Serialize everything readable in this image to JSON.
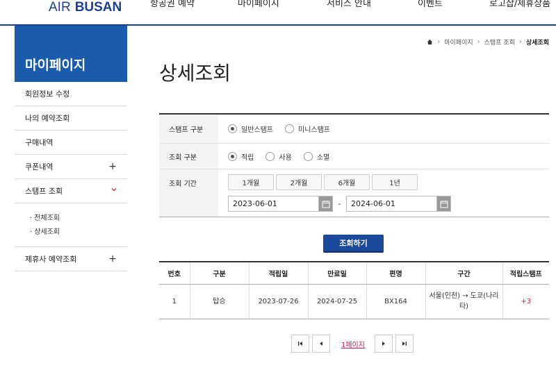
{
  "header": {
    "logo": {
      "air": "AIR",
      "busan": "BUSAN"
    },
    "menu": [
      "항공권 예약",
      "마이페이지",
      "서비스 안내",
      "이벤트",
      "로고샵/제휴상품"
    ]
  },
  "sidebar": {
    "title": "마이페이지",
    "items": [
      {
        "label": "회원정보 수정"
      },
      {
        "label": "나의 예약조회"
      },
      {
        "label": "구매내역"
      },
      {
        "label": "쿠폰내역",
        "expand": "+"
      },
      {
        "label": "스탬프 조회"
      },
      {
        "label": "제휴사 예약조회",
        "expand": "+"
      }
    ],
    "sub_items": [
      "전체조회",
      "상세조회"
    ]
  },
  "breadcrumb": [
    "마이페이지",
    "스탬프 조회",
    "상세조회"
  ],
  "page_title": "상세조회",
  "form": {
    "stamp_type": {
      "label": "스탬프 구분",
      "options": [
        "일반스탬프",
        "미니스탬프"
      ],
      "selected": "일반스탬프"
    },
    "search_type": {
      "label": "조회 구분",
      "options": [
        "적립",
        "사용",
        "소멸"
      ],
      "selected": "적립"
    },
    "period": {
      "label": "조회 기간",
      "buttons": [
        "1개월",
        "2개월",
        "6개월",
        "1년"
      ],
      "start": "2023-06-01",
      "separator": "-",
      "end": "2024-06-01"
    }
  },
  "search_button": "조회하기",
  "table": {
    "columns": [
      "번호",
      "구분",
      "적립일",
      "만료일",
      "편명",
      "구간",
      "적립스탬프"
    ],
    "rows": [
      {
        "no": "1",
        "type": "탑승",
        "earned": "2023-07-26",
        "expires": "2024-07-25",
        "flight": "BX164",
        "route": "서울(인천) → 도쿄(나리타)",
        "stamps": "+3"
      }
    ]
  },
  "pagination": {
    "current": "1페이지"
  },
  "colors": {
    "brand": "#1d3f8f",
    "sidebar_title_bg": "#1b5bab",
    "search_button_bg": "#1b4a9c",
    "accent": "#c2185b"
  }
}
